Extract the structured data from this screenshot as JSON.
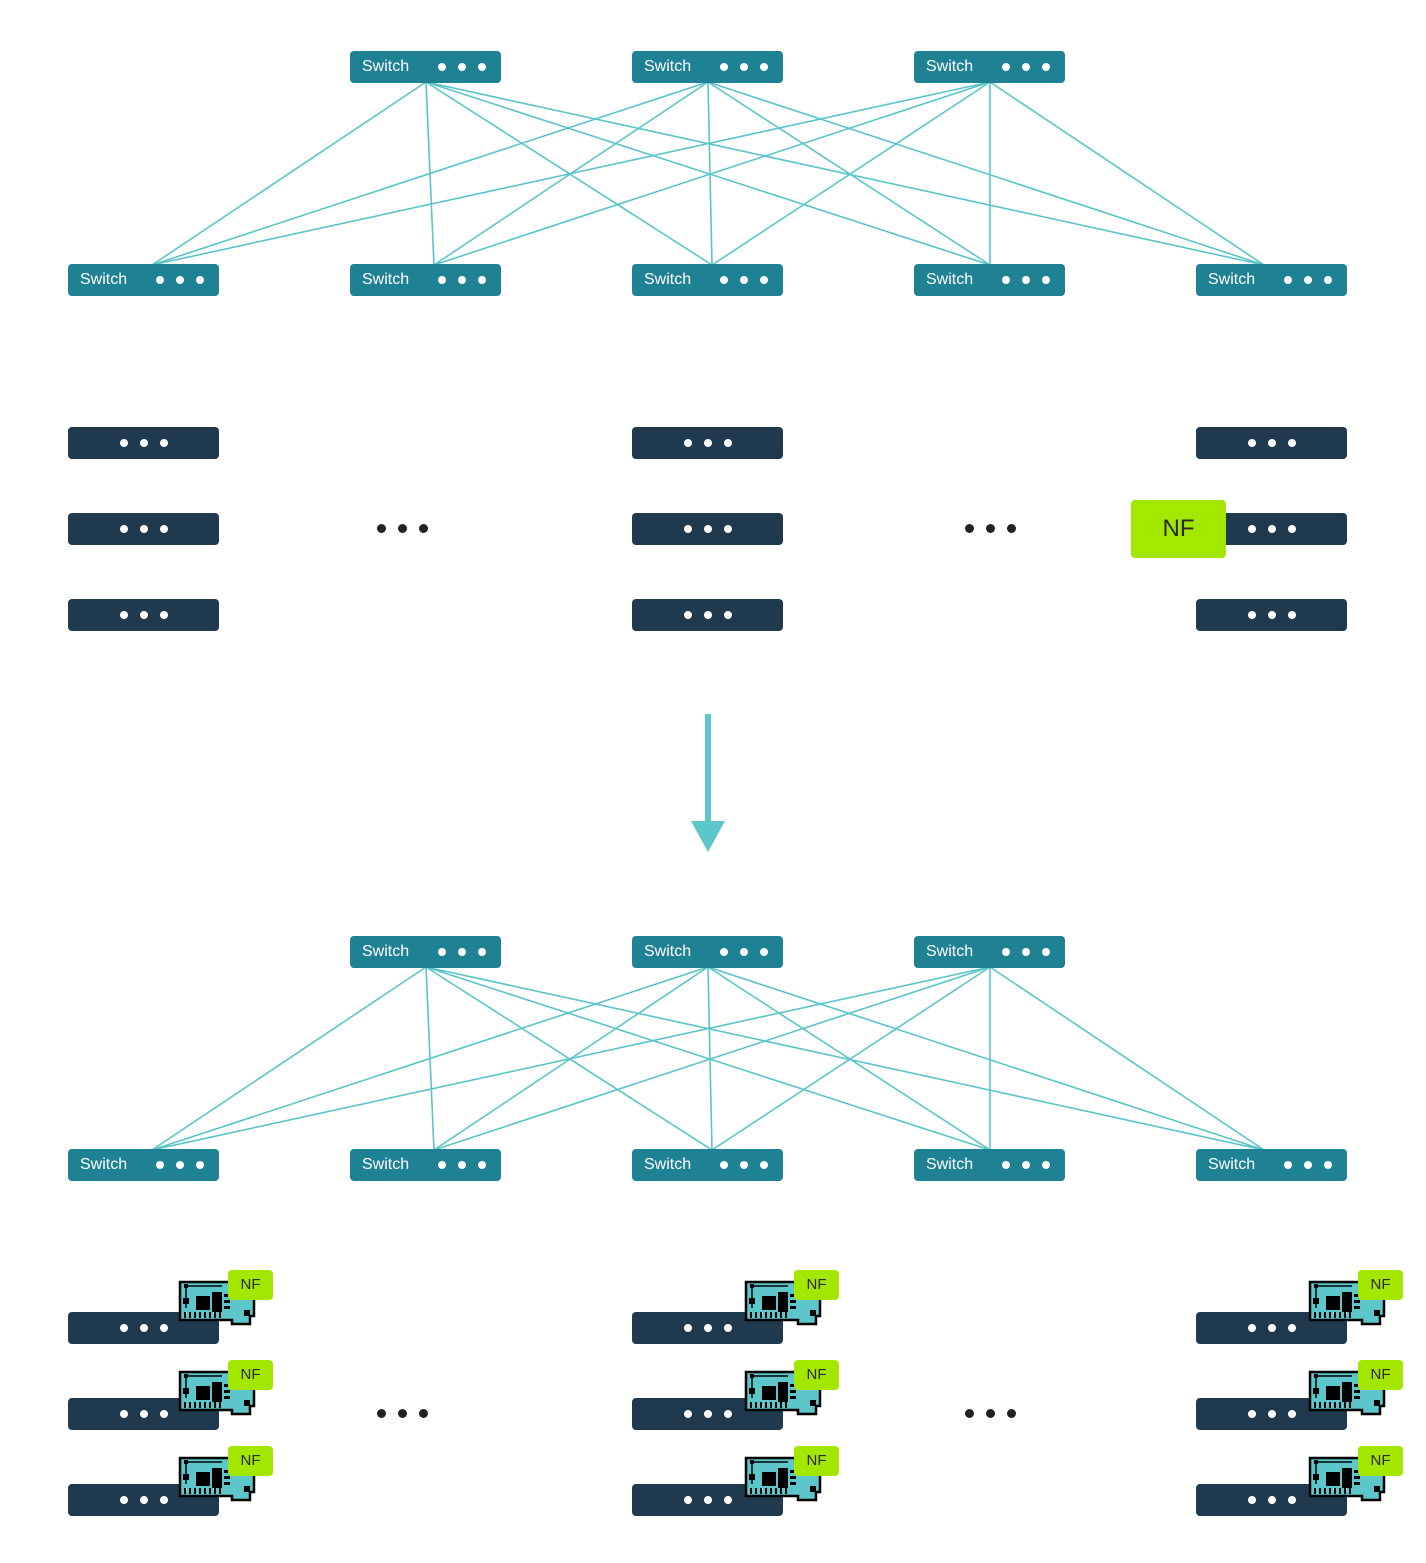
{
  "diagram": {
    "title": "",
    "colors": {
      "switch": "#1e8194",
      "server": "#1f3a4e",
      "link": "#5ac5c9",
      "nf": "#a3e600",
      "arrow": "#5cc6cb",
      "nic_board": "#5cc6cb"
    },
    "before": {
      "spine_switches": [
        {
          "label": "Switch"
        },
        {
          "label": "Switch"
        },
        {
          "label": "Switch"
        }
      ],
      "leaf_switches": [
        {
          "label": "Switch"
        },
        {
          "label": "Switch"
        },
        {
          "label": "Switch"
        },
        {
          "label": "Switch"
        },
        {
          "label": "Switch"
        }
      ],
      "links": "full-mesh spine to leaf",
      "server_columns": [
        {
          "servers": 3
        },
        {
          "servers": 3
        },
        {
          "servers": 3,
          "nf_attached_to_server_index": 1
        }
      ],
      "nf_label": "NF",
      "ellipsis": "…"
    },
    "transition": {
      "icon": "arrow-down-icon"
    },
    "after": {
      "spine_switches": [
        {
          "label": "Switch"
        },
        {
          "label": "Switch"
        },
        {
          "label": "Switch"
        }
      ],
      "leaf_switches": [
        {
          "label": "Switch"
        },
        {
          "label": "Switch"
        },
        {
          "label": "Switch"
        },
        {
          "label": "Switch"
        },
        {
          "label": "Switch"
        }
      ],
      "links": "full-mesh spine to leaf",
      "server_columns": [
        {
          "servers": 3,
          "nic_each": true
        },
        {
          "servers": 3,
          "nic_each": true
        },
        {
          "servers": 3,
          "nic_each": true
        }
      ],
      "nic_icon": "network-card-icon",
      "nf_label": "NF",
      "ellipsis": "…"
    }
  }
}
